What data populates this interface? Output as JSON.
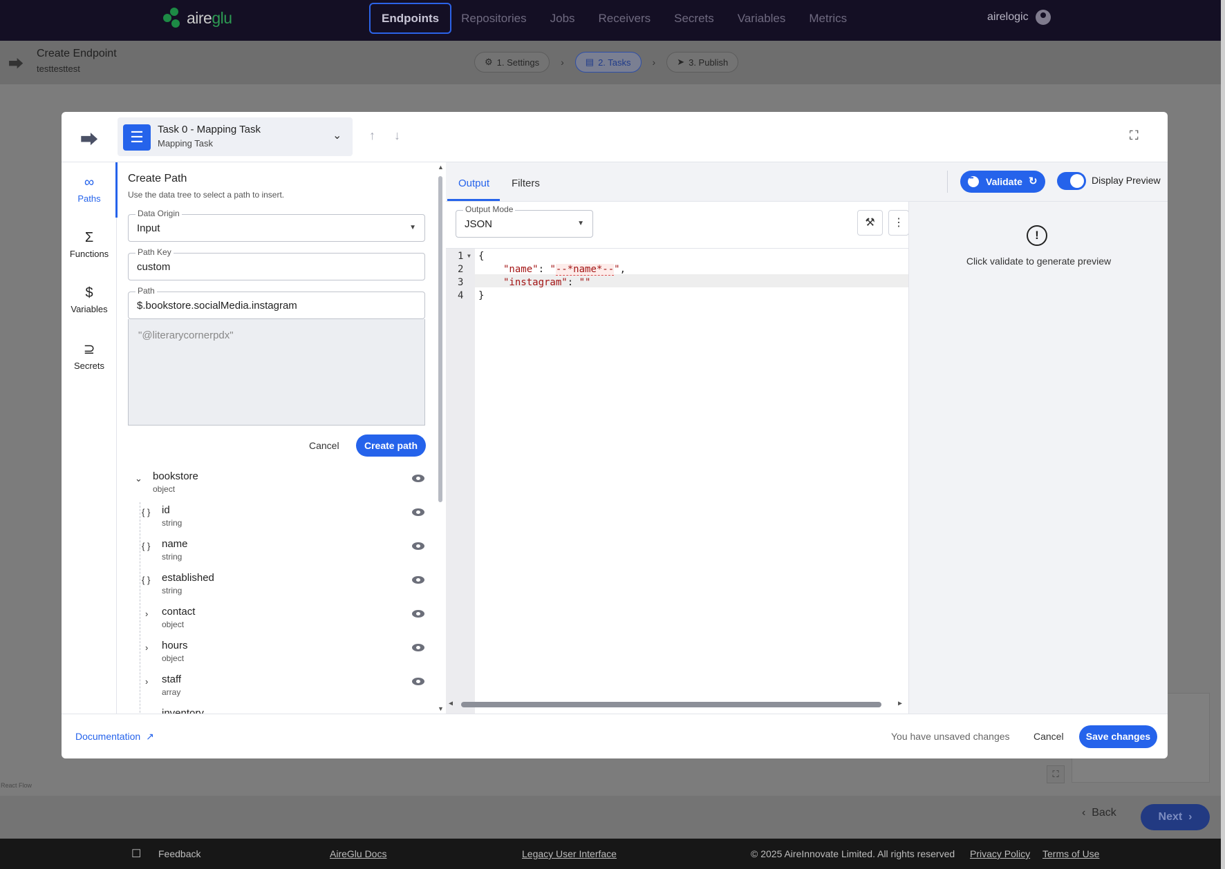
{
  "app": {
    "logo": {
      "prefix": "aire",
      "suffix": "glu"
    },
    "nav": [
      "Endpoints",
      "Repositories",
      "Jobs",
      "Receivers",
      "Secrets",
      "Variables",
      "Metrics"
    ],
    "user": "airelogic"
  },
  "page": {
    "title": "Create Endpoint",
    "subtitle": "testtesttest",
    "steps": [
      "1. Settings",
      "2. Tasks",
      "3. Publish"
    ]
  },
  "modal": {
    "task": {
      "name": "Task 0 - Mapping Task",
      "type": "Mapping Task"
    },
    "rail": [
      {
        "label": "Paths",
        "icon": "link-icon"
      },
      {
        "label": "Functions",
        "icon": "sigma-icon"
      },
      {
        "label": "Variables",
        "icon": "dollar-icon"
      },
      {
        "label": "Secrets",
        "icon": "key-icon"
      }
    ],
    "create_path": {
      "title": "Create Path",
      "hint": "Use the data tree to select a path to insert.",
      "data_origin_label": "Data Origin",
      "data_origin_value": "Input",
      "path_key_label": "Path Key",
      "path_key_value": "custom",
      "path_label": "Path",
      "path_value": "$.bookstore.socialMedia.instagram",
      "preview_value": "\"@literarycornerpdx\"",
      "cancel": "Cancel",
      "create": "Create path"
    },
    "tree": {
      "root": {
        "name": "bookstore",
        "type": "object"
      },
      "children": [
        {
          "name": "id",
          "type": "string",
          "kind": "leaf"
        },
        {
          "name": "name",
          "type": "string",
          "kind": "leaf"
        },
        {
          "name": "established",
          "type": "string",
          "kind": "leaf"
        },
        {
          "name": "contact",
          "type": "object",
          "kind": "branch"
        },
        {
          "name": "hours",
          "type": "object",
          "kind": "branch"
        },
        {
          "name": "staff",
          "type": "array",
          "kind": "branch"
        },
        {
          "name": "inventory",
          "type": "",
          "kind": "branch"
        }
      ]
    },
    "tabs": {
      "output": "Output",
      "filters": "Filters"
    },
    "validate": "Validate",
    "display_preview": "Display Preview",
    "output_mode_label": "Output Mode",
    "output_mode_value": "JSON",
    "code": {
      "line_numbers": [
        "1",
        "2",
        "3",
        "4"
      ],
      "open_brace": "{",
      "close_brace": "}",
      "key1": "\"name\"",
      "val1_marker": "--*name*--",
      "key2": "\"instagram\"",
      "val2": "\"\""
    },
    "preview_message": "Click validate to generate preview",
    "footer": {
      "documentation": "Documentation",
      "unsaved": "You have unsaved changes",
      "cancel": "Cancel",
      "save": "Save changes"
    }
  },
  "bottom": {
    "react_flow": "React Flow",
    "back": "Back",
    "next": "Next"
  },
  "footer": {
    "feedback": "Feedback",
    "docs": "AireGlu Docs",
    "legacy": "Legacy User Interface",
    "copyright": "© 2025 AireInnovate Limited. All rights reserved",
    "privacy": "Privacy Policy",
    "terms": "Terms of Use"
  },
  "colors": {
    "accent": "#2563eb",
    "nav_bg": "#140f24",
    "brand_green": "#2d9a52"
  }
}
